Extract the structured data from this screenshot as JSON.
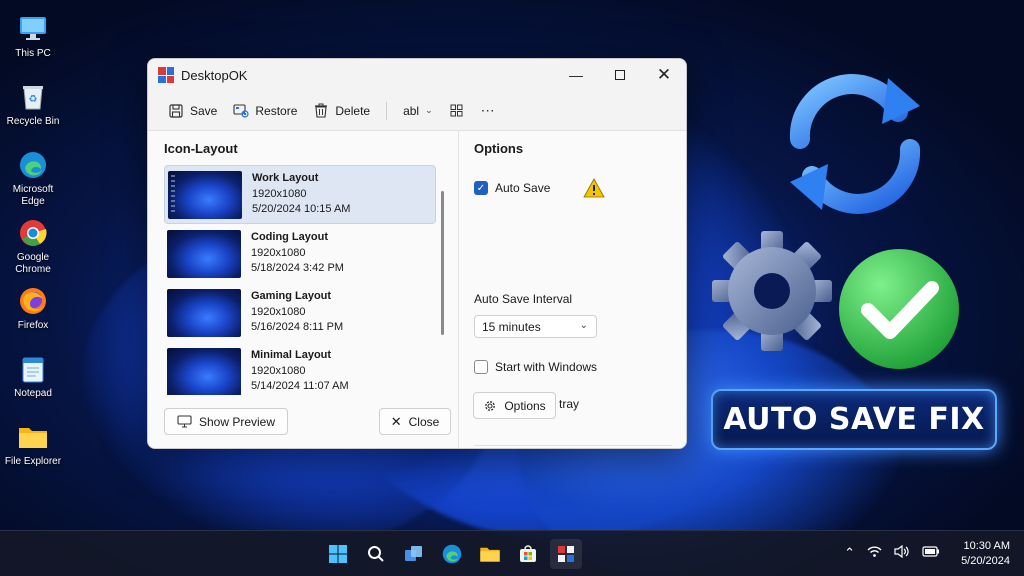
{
  "desktop_icons": [
    {
      "label": "This PC",
      "icon": "computer-icon"
    },
    {
      "label": "Recycle Bin",
      "icon": "recycle-bin-icon"
    },
    {
      "label": "Microsoft Edge",
      "icon": "edge-icon"
    },
    {
      "label": "Google Chrome",
      "icon": "chrome-icon"
    },
    {
      "label": "Firefox",
      "icon": "firefox-icon"
    },
    {
      "label": "Notepad",
      "icon": "notepad-icon"
    },
    {
      "label": "File Explorer",
      "icon": "folder-icon"
    }
  ],
  "window": {
    "title": "DesktopOK",
    "toolbar": {
      "save": "Save",
      "restore": "Restore",
      "delete": "Delete",
      "font": "abl"
    },
    "left": {
      "title": "Icon-Layout",
      "items": [
        {
          "name": "Work Layout",
          "resolution": "1920x1080",
          "date": "5/20/2024 10:15 AM",
          "selected": true
        },
        {
          "name": "Coding Layout",
          "resolution": "1920x1080",
          "date": "5/18/2024 3:42 PM"
        },
        {
          "name": "Gaming Layout",
          "resolution": "1920x1080",
          "date": "5/16/2024 8:11 PM"
        },
        {
          "name": "Minimal Layout",
          "resolution": "1920x1080",
          "date": "5/14/2024 11:07 AM"
        }
      ],
      "show_preview": "Show Preview",
      "close": "Close"
    },
    "right": {
      "title": "Options",
      "auto_save": {
        "label": "Auto Save",
        "checked": true
      },
      "interval_label": "Auto Save Interval",
      "interval_value": "15 minutes",
      "start_with_windows": {
        "label": "Start with Windows",
        "checked": false
      },
      "minimize_to_tray": {
        "label": "Minimize to tray",
        "checked": true
      },
      "options_button": "Options"
    }
  },
  "badge_text": "AUTO SAVE FIX",
  "taskbar": {
    "time": "10:30 AM",
    "date": "5/20/2024"
  },
  "colors": {
    "accent": "#1f5fbf",
    "check_green": "#2fb84a",
    "badge_glow": "#3b8cff"
  }
}
